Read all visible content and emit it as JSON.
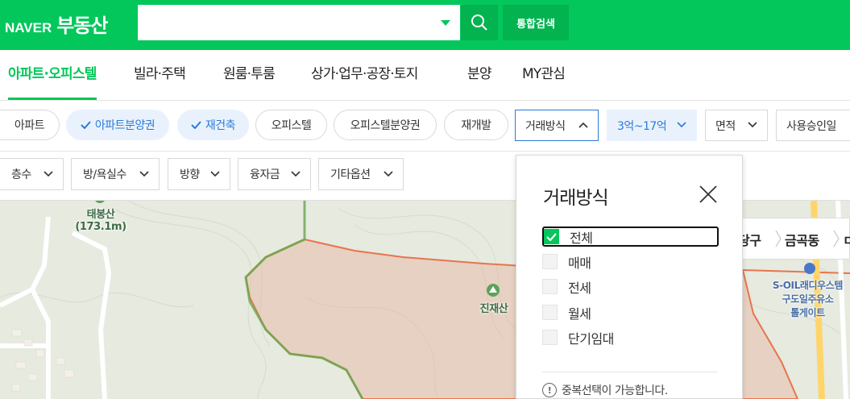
{
  "header": {
    "logo_naver": "NAVER",
    "logo_text": "부동산",
    "search_placeholder": "",
    "search_all_label": "통합검색"
  },
  "tabs": [
    {
      "label": "아파트·오피스텔",
      "active": true
    },
    {
      "label": "빌라·주택",
      "active": false
    },
    {
      "label": "원룸·투룸",
      "active": false
    },
    {
      "label": "상가·업무·공장·토지",
      "active": false
    },
    {
      "label": "분양",
      "active": false
    },
    {
      "label": "MY관심",
      "active": false
    }
  ],
  "property_types": [
    {
      "label": "아파트",
      "selected": false
    },
    {
      "label": "아파트분양권",
      "selected": true
    },
    {
      "label": "재건축",
      "selected": true
    },
    {
      "label": "오피스텔",
      "selected": false
    },
    {
      "label": "오피스텔분양권",
      "selected": false
    },
    {
      "label": "재개발",
      "selected": false
    }
  ],
  "filters_row1": {
    "trade": "거래방식",
    "price": "3억~17억",
    "area": "면적",
    "approval": "사용승인일"
  },
  "filters_row2": [
    "층수",
    "방/욕실수",
    "방향",
    "융자금",
    "기타옵션"
  ],
  "map": {
    "mountain1_name": "태봉산",
    "mountain1_height": "(173.1m)",
    "mountain2_name": "진재산",
    "breadcrumb": [
      "당구",
      "금곡동",
      "ㄷ"
    ],
    "poi_lines": [
      "S-OIL래디우스템",
      "구도일주유소",
      "톨게이트"
    ]
  },
  "popup": {
    "title": "거래방식",
    "options": [
      {
        "label": "전체",
        "checked": true
      },
      {
        "label": "매매",
        "checked": false
      },
      {
        "label": "전세",
        "checked": false
      },
      {
        "label": "월세",
        "checked": false
      },
      {
        "label": "단기임대",
        "checked": false
      }
    ],
    "note": "중복선택이 가능합니다."
  },
  "colors": {
    "brand_green": "#03c75a",
    "selected_blue": "#2a7ad9"
  }
}
